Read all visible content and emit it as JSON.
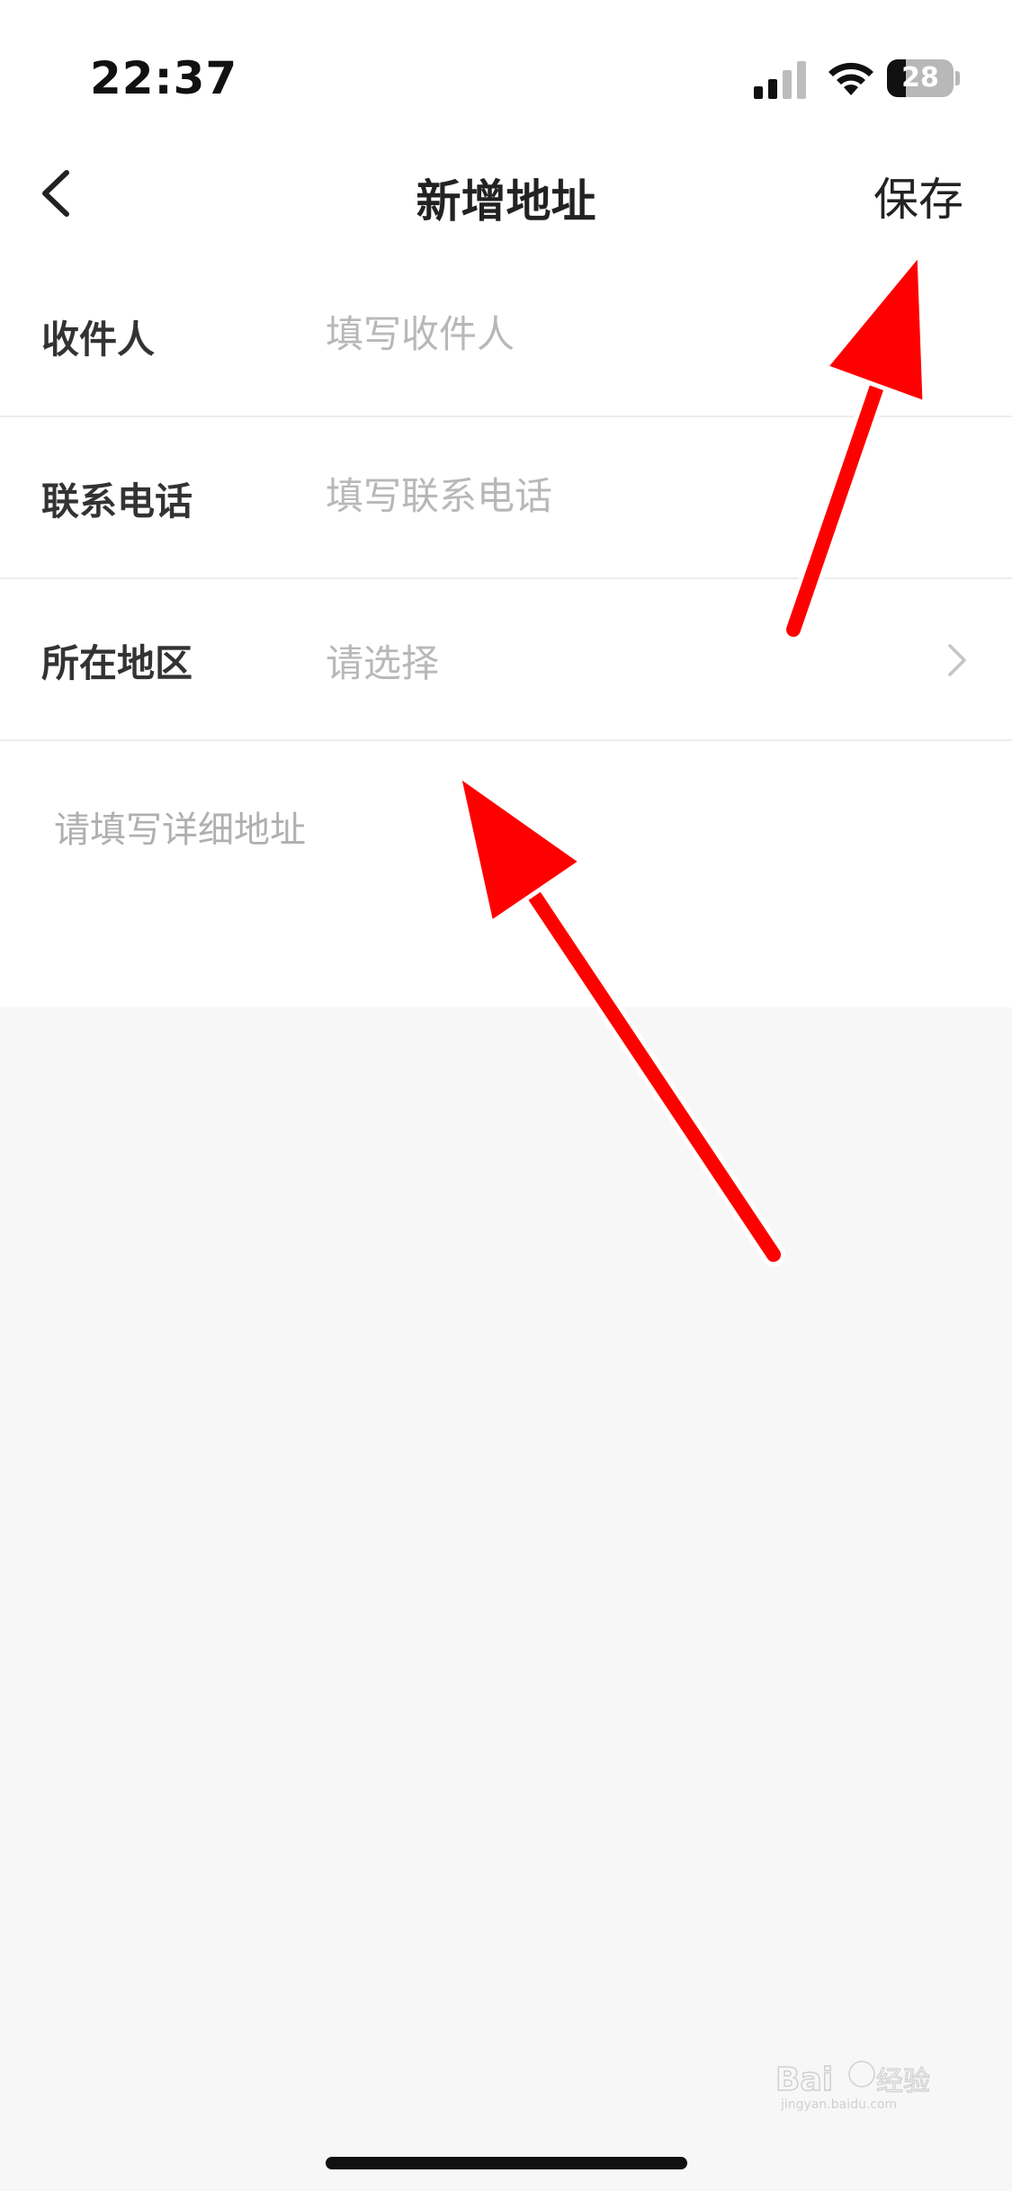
{
  "status_bar": {
    "time": "22:37",
    "battery_level": "28",
    "battery_fraction": 0.28
  },
  "nav": {
    "title": "新增地址",
    "save_label": "保存",
    "back_icon": "chevron-left-icon"
  },
  "form": {
    "recipient": {
      "label": "收件人",
      "placeholder": "填写收件人"
    },
    "phone": {
      "label": "联系电话",
      "placeholder": "填写联系电话"
    },
    "region": {
      "label": "所在地区",
      "placeholder": "请选择",
      "icon": "chevron-right-icon"
    },
    "detail": {
      "placeholder": "请填写详细地址"
    }
  },
  "colors": {
    "annotation_arrow": "#ff0000",
    "page_background": "#f7f7f7",
    "placeholder_text": "#b8b8b8"
  },
  "watermark": {
    "brand": "Baidu经验",
    "url": "jingyan.baidu.com"
  }
}
